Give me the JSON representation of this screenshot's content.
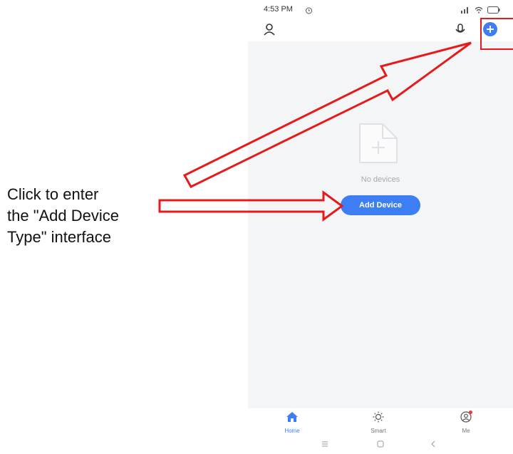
{
  "caption": {
    "line1": "Click to enter",
    "line2": "the \"Add Device",
    "line3": "Type\" interface"
  },
  "status_bar": {
    "time": "4:53 PM"
  },
  "header": {
    "icons": [
      "user-icon",
      "microphone-icon",
      "add-icon"
    ]
  },
  "main": {
    "empty_text": "No devices",
    "add_device_label": "Add Device"
  },
  "tabs": [
    {
      "label": "Home",
      "icon": "home-icon",
      "active": true
    },
    {
      "label": "Smart",
      "icon": "sun-icon",
      "active": false
    },
    {
      "label": "Me",
      "icon": "profile-icon",
      "active": false
    }
  ],
  "colors": {
    "accent": "#3d7ef5",
    "annotation": "#e51b1b",
    "background": "#f4f5f7"
  }
}
